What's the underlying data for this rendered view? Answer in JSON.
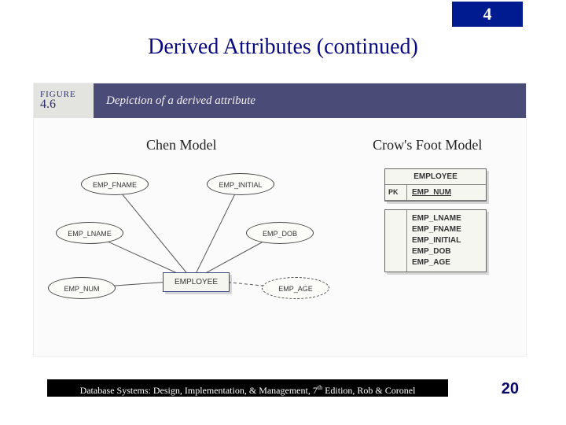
{
  "chapter": "4",
  "title": "Derived Attributes (continued)",
  "figure": {
    "label_top": "FIGURE",
    "number": "4.6",
    "caption": "Depiction of a derived attribute"
  },
  "models": {
    "left": "Chen Model",
    "right": "Crow's Foot Model"
  },
  "chen": {
    "entity": "EMPLOYEE",
    "attrs": {
      "fname": "EMP_FNAME",
      "initial": "EMP_INITIAL",
      "lname": "EMP_LNAME",
      "dob": "EMP_DOB",
      "num": "EMP_NUM",
      "age": "EMP_AGE"
    }
  },
  "crows": {
    "entity": "EMPLOYEE",
    "pk_label": "PK",
    "pk_attr": "EMP_NUM",
    "attrs": [
      "EMP_LNAME",
      "EMP_FNAME",
      "EMP_INITIAL",
      "EMP_DOB",
      "EMP_AGE"
    ]
  },
  "footer": {
    "text_pre": "Database Systems: Design, Implementation, & Management, 7",
    "sup": "th",
    "text_post": " Edition, Rob & Coronel"
  },
  "page": "20"
}
